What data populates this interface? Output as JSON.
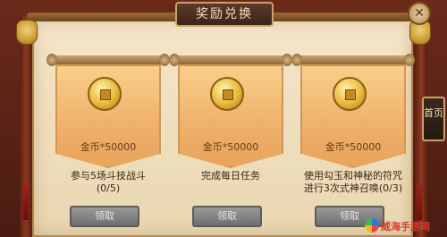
{
  "window": {
    "title": "奖励兑换",
    "close_icon": "close-icon",
    "side_tab_label": "首页"
  },
  "rewards": [
    {
      "amount": "金币*50000",
      "icon": "coin-icon",
      "task": "参与5场斗技战斗\n(0/5)",
      "claim_label": "领取"
    },
    {
      "amount": "金币*50000",
      "icon": "coin-icon",
      "task": "完成每日任务",
      "claim_label": "领取"
    },
    {
      "amount": "金币*50000",
      "icon": "coin-icon",
      "task": "使用勾玉和神秘的符咒\n进行3次式神召唤(0/3)",
      "claim_label": "领取"
    }
  ],
  "watermark": "威海手游网",
  "colors": {
    "banner": "#efb06a",
    "panel": "#f4e6c9",
    "button_disabled": "#7f7f7f",
    "title_plate": "#3c2418"
  }
}
